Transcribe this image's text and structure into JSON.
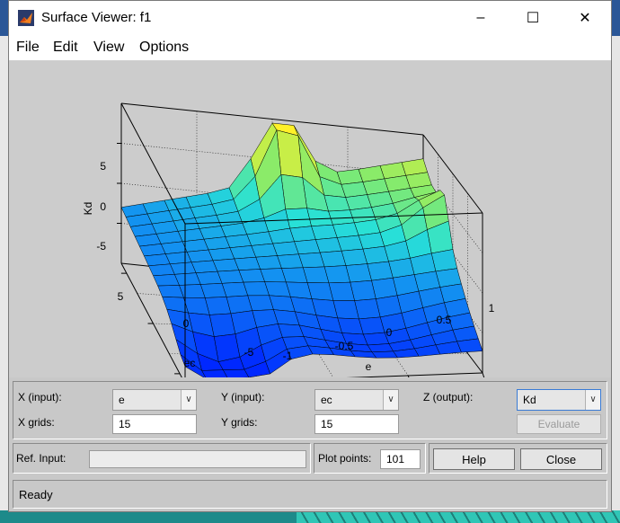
{
  "window": {
    "title": "Surface Viewer: f1",
    "icon": "matlab-icon",
    "controls": {
      "minimize": "–",
      "maximize": "☐",
      "close": "✕"
    }
  },
  "menu": [
    "File",
    "Edit",
    "View",
    "Options"
  ],
  "plot": {
    "zlabel": "Kd",
    "xlabel": "e",
    "ylabel": "ec",
    "z_ticks": [
      "5",
      "0",
      "-5"
    ],
    "e_ticks": [
      "-1",
      "-0.5",
      "0",
      "0.5",
      "1"
    ],
    "ec_ticks": [
      "5",
      "0",
      "-5"
    ],
    "e_range": [
      -1,
      1
    ],
    "ec_range": [
      -6,
      6
    ],
    "z_range": [
      -10,
      10
    ]
  },
  "controls": {
    "x_input_label": "X (input):",
    "x_input_value": "e",
    "y_input_label": "Y (input):",
    "y_input_value": "ec",
    "z_output_label": "Z (output):",
    "z_output_value": "Kd",
    "x_grids_label": "X grids:",
    "x_grids_value": "15",
    "y_grids_label": "Y grids:",
    "y_grids_value": "15",
    "evaluate_label": "Evaluate"
  },
  "ref": {
    "ref_input_label": "Ref. Input:",
    "ref_input_value": "",
    "plot_points_label": "Plot points:",
    "plot_points_value": "101",
    "help_label": "Help",
    "close_label": "Close"
  },
  "status": {
    "text": "Ready"
  },
  "colors": {
    "surface_low": "#1f5fff",
    "surface_mid": "#2ee0d8",
    "surface_high": "#ffee33"
  }
}
